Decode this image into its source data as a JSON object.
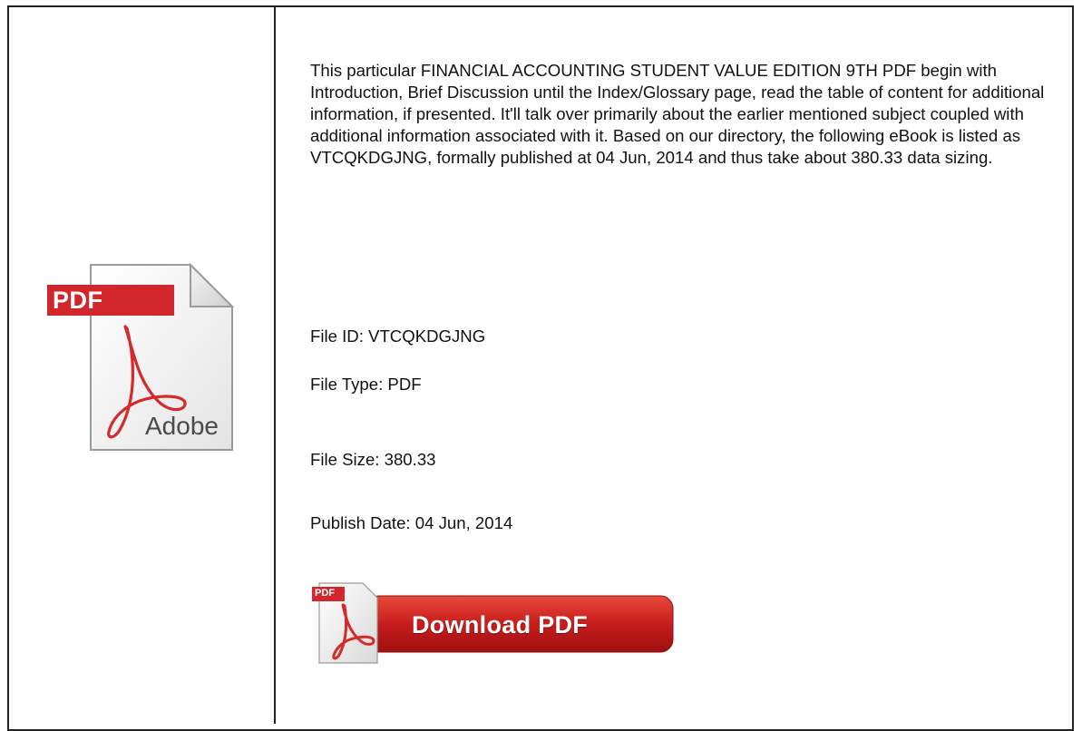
{
  "description": "This particular FINANCIAL ACCOUNTING STUDENT VALUE EDITION 9TH PDF begin with Introduction, Brief Discussion until the Index/Glossary page, read the table of content for additional information, if presented. It'll talk over primarily about the earlier mentioned subject coupled with additional information associated with it. Based on our directory, the following eBook is listed as VTCQKDGJNG, formally published at 04 Jun, 2014 and thus take about 380.33 data sizing.",
  "file_info": {
    "file_id": "File ID: VTCQKDGJNG",
    "file_type": "File Type: PDF",
    "file_size": "File Size: 380.33",
    "publish_date": "Publish Date: 04 Jun, 2014"
  },
  "pdf_icon": {
    "badge_text": "PDF",
    "brand_text": "Adobe",
    "icon": "pdf-document-icon"
  },
  "download_button": {
    "label": "Download PDF",
    "badge_text": "PDF",
    "icon": "acrobat-icon"
  },
  "colors": {
    "badge_red": "#d0262c",
    "acrobat_red": "#d62a2a",
    "button_red": "#c01818",
    "border": "#222222"
  }
}
